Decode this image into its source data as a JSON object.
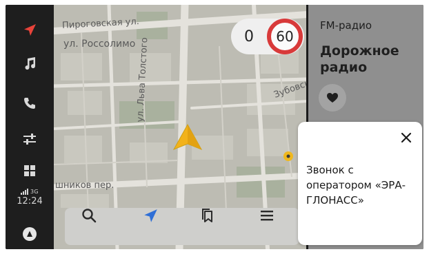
{
  "rail": {
    "items": [
      {
        "name": "navigation",
        "icon": "navigation-arrow-icon",
        "color": "#e8433a"
      },
      {
        "name": "music",
        "icon": "music-note-icon"
      },
      {
        "name": "phone",
        "icon": "phone-icon"
      },
      {
        "name": "settings",
        "icon": "sliders-icon"
      },
      {
        "name": "apps",
        "icon": "grid-icon"
      }
    ],
    "network": "3G",
    "time": "12:24",
    "assistant_icon": "alice-icon"
  },
  "map": {
    "streets": [
      "Пироговская ул.",
      "ул. Россолимо",
      "ул. Льва Толстого",
      "Зубовск",
      "шников пер."
    ],
    "speed_current": "0",
    "speed_limit": "60",
    "speed_limit_color": "#d83a3a",
    "cursor_color": "#f2b21b",
    "toolbar": [
      {
        "name": "search",
        "icon": "search-icon"
      },
      {
        "name": "route",
        "icon": "navigation-arrow-icon",
        "color": "#2f6fd6"
      },
      {
        "name": "bookmarks",
        "icon": "bookmarks-icon"
      },
      {
        "name": "menu",
        "icon": "menu-icon"
      }
    ]
  },
  "radio": {
    "source": "FM-радио",
    "station": "Дорожное радио"
  },
  "notice": {
    "text": "Звонок с оператором «ЭРА-ГЛОНАСС»"
  }
}
